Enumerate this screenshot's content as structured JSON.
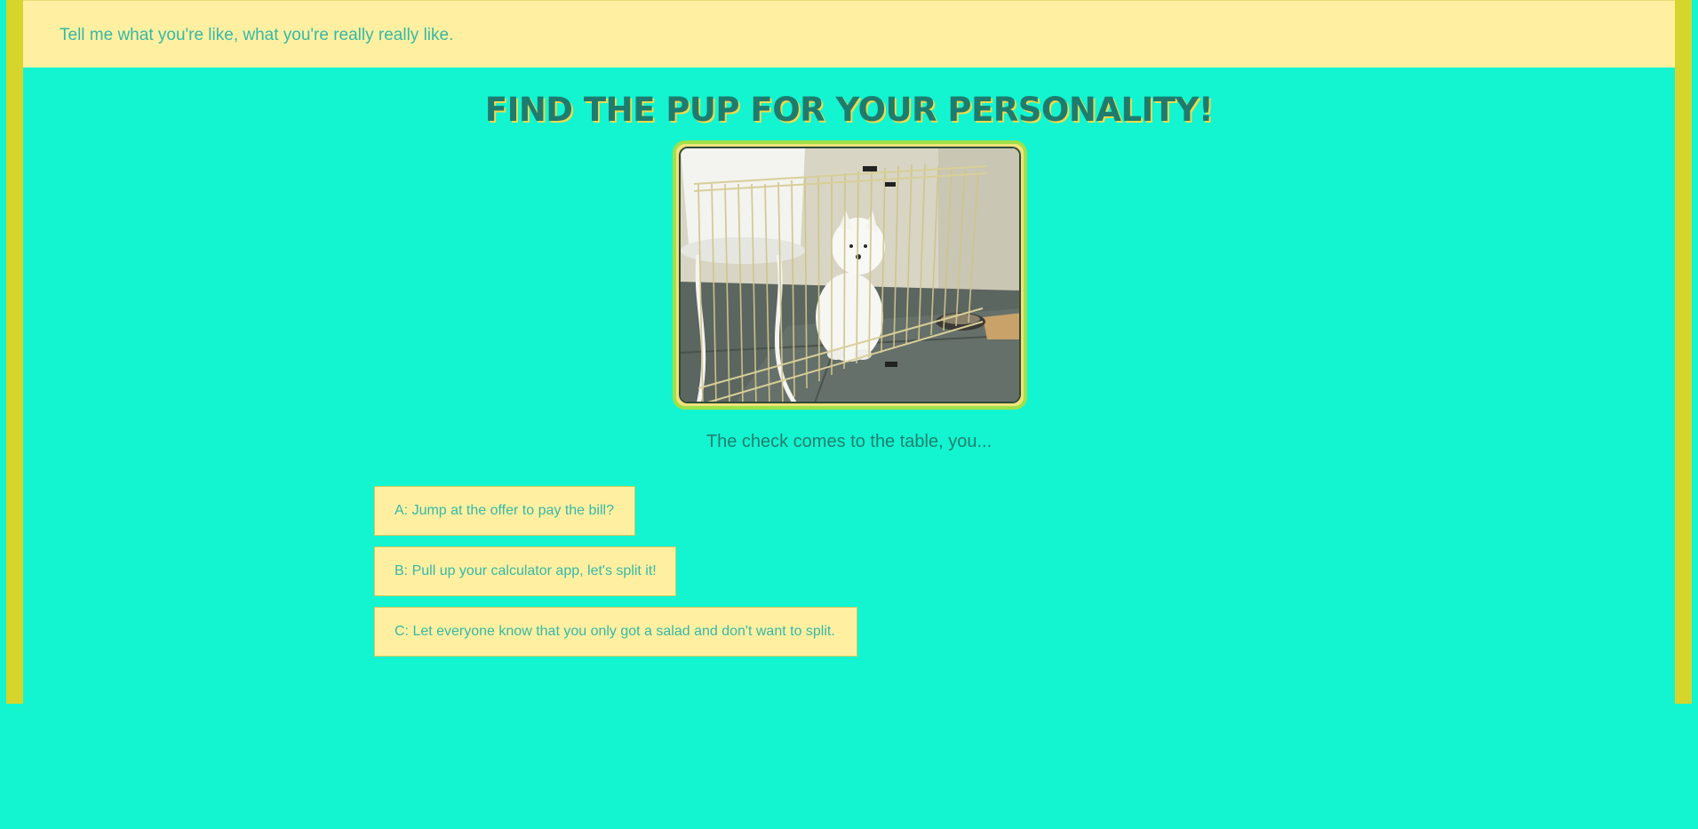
{
  "banner": {
    "text": "Tell me what you're like, what you're really really like."
  },
  "quiz": {
    "title": "FIND THE PUP FOR YOUR PERSONALITY!",
    "image_alt": "white puppy sitting in a wire playpen",
    "question": "The check comes to the table, you...",
    "answers": [
      {
        "label": "A: Jump at the offer to pay the bill?"
      },
      {
        "label": "B: Pull up your calculator app, let's split it!"
      },
      {
        "label": "C: Let everyone know that you only got a salad and don't want to split."
      }
    ]
  },
  "colors": {
    "background": "#12f5d0",
    "banner": "#fff0a1",
    "accent_text": "#35b8a6",
    "title_text": "#1e7c6f",
    "border": "#d6d52c"
  }
}
